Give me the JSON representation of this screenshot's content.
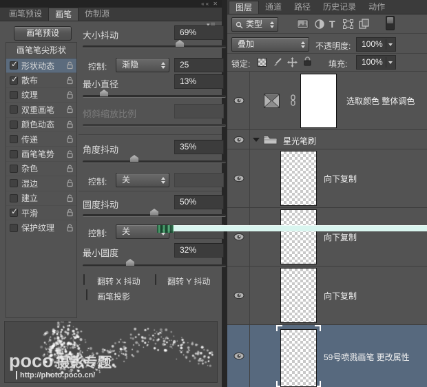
{
  "window": {
    "collapse_icon": "«",
    "close_icon": "✕"
  },
  "colors": {
    "panel_bg": "#535353",
    "selected_row": "#57697e",
    "sidebar_selected": "#5b6b7d",
    "cyan_artifact": "#d9f5ef"
  },
  "brush_panel": {
    "tabs": [
      {
        "label": "画笔预设",
        "active": false
      },
      {
        "label": "画笔",
        "active": true
      },
      {
        "label": "仿制源",
        "active": false
      }
    ],
    "preset_button": "画笔预设",
    "tip_shape_header": "画笔笔尖形状",
    "sections": [
      {
        "label": "形状动态",
        "checked": true,
        "selected": true
      },
      {
        "label": "散布",
        "checked": true,
        "selected": false
      },
      {
        "label": "纹理",
        "checked": false,
        "selected": false
      },
      {
        "label": "双重画笔",
        "checked": false,
        "selected": false
      },
      {
        "label": "颜色动态",
        "checked": false,
        "selected": false
      },
      {
        "label": "传递",
        "checked": false,
        "selected": false
      },
      {
        "label": "画笔笔势",
        "checked": false,
        "selected": false
      },
      {
        "label": "杂色",
        "checked": false,
        "selected": false
      },
      {
        "label": "湿边",
        "checked": false,
        "selected": false
      },
      {
        "label": "建立",
        "checked": false,
        "selected": false
      },
      {
        "label": "平滑",
        "checked": true,
        "selected": false
      },
      {
        "label": "保护纹理",
        "checked": false,
        "selected": false
      }
    ],
    "settings": {
      "size_jitter": {
        "label": "大小抖动",
        "value": "69%",
        "percent": 69
      },
      "control_size": {
        "label": "控制:",
        "value": "渐隐",
        "amount": "25"
      },
      "min_diameter": {
        "label": "最小直径",
        "value": "13%",
        "percent": 13
      },
      "tilt_scale": {
        "label": "倾斜缩放比例",
        "value": "",
        "disabled": true
      },
      "angle_jitter": {
        "label": "角度抖动",
        "value": "35%",
        "percent": 35
      },
      "control_angle": {
        "label": "控制:",
        "value": "关"
      },
      "roundness_jitter": {
        "label": "圆度抖动",
        "value": "50%",
        "percent": 50
      },
      "control_roundness": {
        "label": "控制:",
        "value": "关"
      },
      "min_roundness": {
        "label": "最小圆度",
        "value": "32%",
        "percent": 32
      },
      "flip_x": {
        "label": "翻转 X 抖动",
        "checked": false
      },
      "flip_y": {
        "label": "翻转 Y 抖动",
        "checked": false
      },
      "brush_projection": {
        "label": "画笔投影",
        "checked": false
      }
    },
    "watermark": {
      "brand": "poco",
      "title": "摄影专题",
      "url": "http://photo.poco.cn/"
    }
  },
  "layers_panel": {
    "tabs": [
      {
        "label": "图层",
        "active": true
      },
      {
        "label": "通道",
        "active": false
      },
      {
        "label": "路径",
        "active": false
      },
      {
        "label": "历史记录",
        "active": false
      },
      {
        "label": "动作",
        "active": false
      }
    ],
    "filter": {
      "kind_label": "类型"
    },
    "blend": {
      "mode": "叠加",
      "opacity_label": "不透明度:",
      "opacity_value": "100%",
      "lock_label": "锁定:",
      "fill_label": "填充:",
      "fill_value": "100%"
    },
    "layers": [
      {
        "type": "adjustment",
        "label": "选取颜色 整体调色",
        "visible": true,
        "selected": false
      },
      {
        "type": "group",
        "label": "星光笔刷",
        "visible": true,
        "selected": false
      },
      {
        "type": "layer",
        "label": "向下复制",
        "visible": true,
        "selected": false
      },
      {
        "type": "layer",
        "label": "向下复制",
        "visible": true,
        "selected": false
      },
      {
        "type": "layer",
        "label": "向下复制",
        "visible": true,
        "selected": false
      },
      {
        "type": "layer",
        "label": "59号喷溅画笔 更改属性",
        "visible": true,
        "selected": true
      }
    ]
  }
}
